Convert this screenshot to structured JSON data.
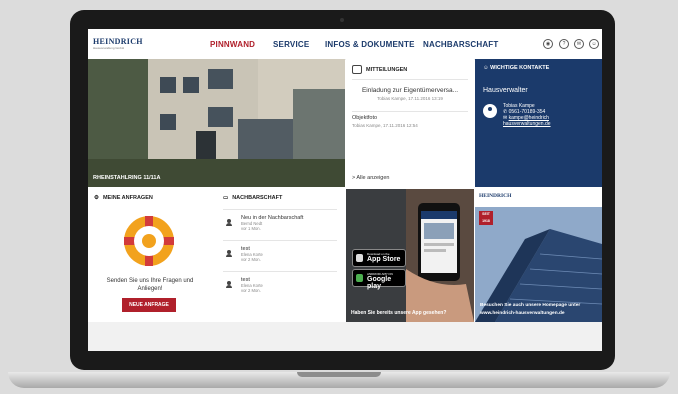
{
  "nav": {
    "logo_main": "HEINDRICH",
    "logo_sub": "Hausverwaltung GmbH",
    "links": [
      "PINNWAND",
      "SERVICE",
      "INFOS & DOKUMENTE",
      "NACHBARSCHAFT"
    ]
  },
  "photo": {
    "caption": "RHEINSTAHLRING 11/11A"
  },
  "messages": {
    "title": "MITTEILUNGEN",
    "items": [
      {
        "title": "Einladung zur Eigentümerversa...",
        "meta": "Tobias Kampe, 17.11.2016 13:19"
      },
      {
        "title": "Objektfoto",
        "meta": "Tobias Kampe, 17.11.2016 12:54"
      }
    ],
    "all_link": "> Alle anzeigen"
  },
  "contacts": {
    "title": "WICHTIGE KONTAKTE",
    "role": "Hausverwalter",
    "name": "Tobias Kampe",
    "phone": "0561-70189-354",
    "email": "kampe@heindrich",
    "web": "hausverwaltungen.de"
  },
  "requests": {
    "title": "MEINE ANFRAGEN",
    "text": "Senden Sie uns Ihre Fragen und Anliegen!",
    "button": "NEUE ANFRAGE"
  },
  "neighborhood": {
    "title": "NACHBARSCHAFT",
    "items": [
      {
        "title": "Neu in der Nachbarschaft",
        "name": "Bernd Nedt",
        "time": "vor 1 Mon."
      },
      {
        "title": "test",
        "name": "Elena Korte",
        "time": "vor 2 Mon."
      },
      {
        "title": "test",
        "name": "Elena Korte",
        "time": "vor 2 Mon."
      }
    ]
  },
  "app": {
    "appstore_small": "Download on the",
    "appstore_big": "App Store",
    "play_small": "ANDROID APP ON",
    "play_big": "Google play",
    "caption": "Haben Sie bereits unsere App gesehen?"
  },
  "homepage": {
    "logo": "HEINDRICH",
    "badge": "SEIT 1918",
    "caption_line1": "Besuchen Sie auch unsere Homepage unter",
    "caption_line2": "www.heindrich-hausverwaltungen.de"
  },
  "colors": {
    "brand_blue": "#1b3a6b",
    "brand_red": "#b0202b",
    "accent_orange": "#f2a21d"
  }
}
